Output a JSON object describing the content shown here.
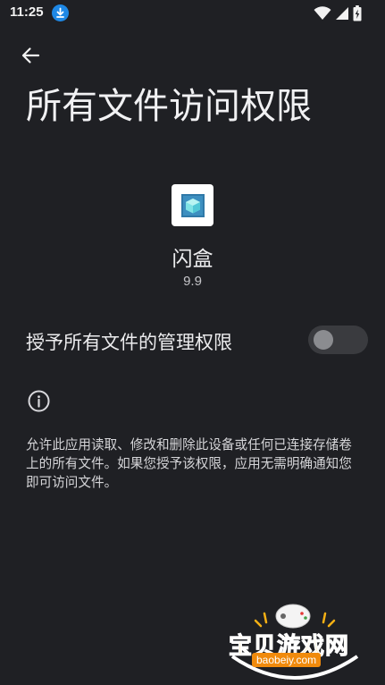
{
  "status_bar": {
    "time": "11:25",
    "icons": [
      "download-icon",
      "wifi-icon",
      "signal-icon",
      "battery-charging-icon"
    ]
  },
  "header": {
    "back_icon": "arrow-left-icon",
    "title": "所有文件访问权限"
  },
  "app": {
    "icon": "app-cube-icon",
    "name": "闪盒",
    "version": "9.9"
  },
  "permission_toggle": {
    "label": "授予所有文件的管理权限",
    "enabled": false
  },
  "info": {
    "icon": "info-icon",
    "description": "允许此应用读取、修改和删除此设备或任何已连接存储卷上的所有文件。如果您授予该权限，应用无需明确通知您即可访问文件。"
  },
  "watermark": {
    "text": "宝贝游戏网",
    "url": "baobeiy.com"
  },
  "colors": {
    "background": "#1f2024",
    "text_primary": "#ececee",
    "switch_track_off": "#3a3b3f",
    "switch_thumb_off": "#8b8c90",
    "download_badge": "#1e88e5",
    "watermark_accent": "#f5b014"
  }
}
